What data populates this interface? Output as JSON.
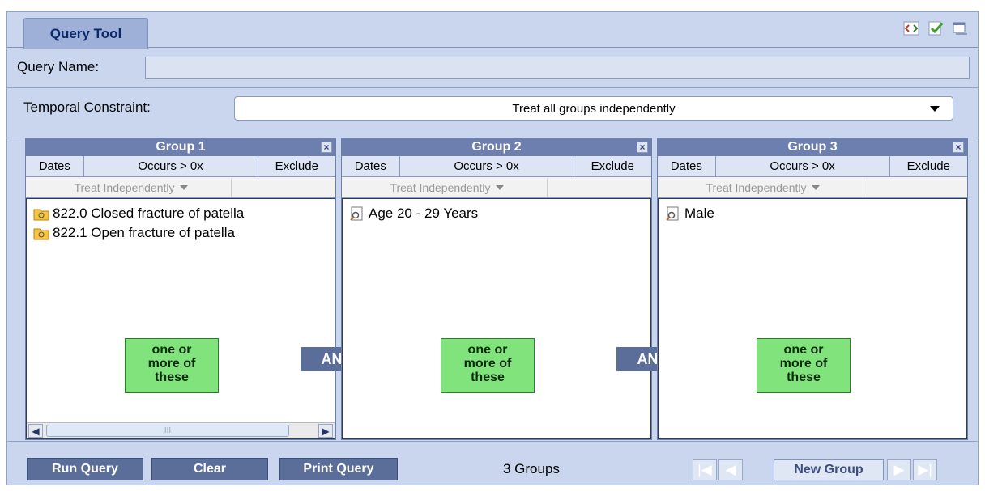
{
  "tab": {
    "label": "Query Tool"
  },
  "tab_icons": [
    "code-view-icon",
    "check-document-icon",
    "window-icon"
  ],
  "query_name": {
    "label": "Query Name:",
    "value": ""
  },
  "temporal": {
    "label": "Temporal Constraint:",
    "selected": "Treat all groups independently"
  },
  "groups": [
    {
      "title": "Group 1",
      "buttons": {
        "dates": "Dates",
        "occurs": "Occurs > 0x",
        "exclude": "Exclude"
      },
      "timing": "Treat Independently",
      "items": [
        "822.0 Closed fracture of patella",
        "822.1 Open fracture of patella"
      ],
      "item_icon": "folder-icon",
      "note": [
        "one or",
        "more of",
        "these"
      ],
      "scroll_mark": "III"
    },
    {
      "title": "Group 2",
      "buttons": {
        "dates": "Dates",
        "occurs": "Occurs > 0x",
        "exclude": "Exclude"
      },
      "timing": "Treat Independently",
      "items": [
        "Age 20 - 29 Years"
      ],
      "item_icon": "document-search-icon",
      "note": [
        "one or",
        "more of",
        "these"
      ]
    },
    {
      "title": "Group 3",
      "buttons": {
        "dates": "Dates",
        "occurs": "Occurs > 0x",
        "exclude": "Exclude"
      },
      "timing": "Treat Independently",
      "items": [
        "Male"
      ],
      "item_icon": "document-search-icon",
      "note": [
        "one or",
        "more of",
        "these"
      ]
    }
  ],
  "connector": "AND",
  "bottom": {
    "run": "Run Query",
    "clear": "Clear",
    "print": "Print Query",
    "count": "3 Groups",
    "new_group": "New Group"
  },
  "colors": {
    "accent": "#5b6e9a",
    "panel": "#c9d6ee",
    "note": "#80e37b"
  }
}
